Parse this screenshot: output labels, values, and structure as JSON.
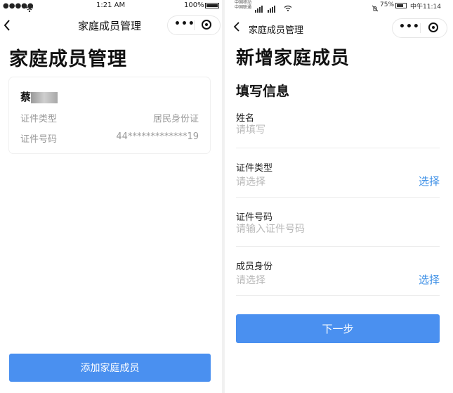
{
  "left": {
    "status": {
      "time": "1:21 AM",
      "battery": "100%"
    },
    "nav": {
      "title": "家庭成员管理",
      "more": "•••"
    },
    "page_title": "家庭成员管理",
    "member": {
      "name": "蔡",
      "rows": [
        {
          "label": "证件类型",
          "value": "居民身份证"
        },
        {
          "label": "证件号码",
          "value": "44*************19"
        }
      ]
    },
    "add_button": "添加家庭成员"
  },
  "right": {
    "status": {
      "carrier1": "中国移动",
      "carrier2": "中国联通",
      "battery": "75%",
      "time": "中午11:14"
    },
    "nav": {
      "title": "家庭成员管理",
      "more": "•••"
    },
    "page_title": "新增家庭成员",
    "section_title": "填写信息",
    "fields": [
      {
        "label": "姓名",
        "placeholder": "请填写",
        "action": ""
      },
      {
        "label": "证件类型",
        "placeholder": "请选择",
        "action": "选择"
      },
      {
        "label": "证件号码",
        "placeholder": "请输入证件号码",
        "action": ""
      },
      {
        "label": "成员身份",
        "placeholder": "请选择",
        "action": "选择"
      }
    ],
    "next_button": "下一步"
  },
  "colors": {
    "primary": "#4a90f0",
    "link": "#3c8fe6",
    "placeholder": "#b9b9b9"
  }
}
